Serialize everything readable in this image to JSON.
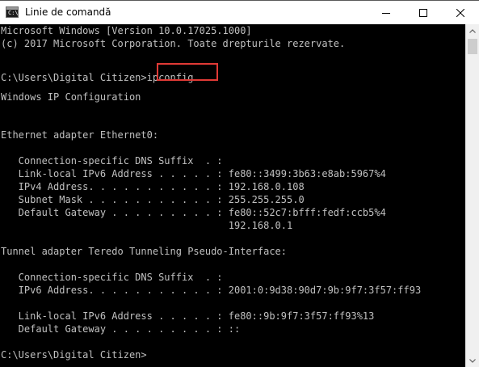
{
  "window": {
    "title": "Linie de comandă",
    "icon_glyph": "C:\\"
  },
  "console": {
    "lines": [
      "Microsoft Windows [Version 10.0.17025.1000]",
      "(c) 2017 Microsoft Corporation. Toate drepturile rezervate.",
      "",
      "C:\\Users\\Digital Citizen>ipconfig",
      "",
      "Windows IP Configuration",
      "",
      "",
      "Ethernet adapter Ethernet0:",
      "",
      "   Connection-specific DNS Suffix  . :",
      "   Link-local IPv6 Address . . . . . : fe80::3499:3b63:e8ab:5967%4",
      "   IPv4 Address. . . . . . . . . . . : 192.168.0.108",
      "   Subnet Mask . . . . . . . . . . . : 255.255.255.0",
      "   Default Gateway . . . . . . . . . : fe80::52c7:bfff:fedf:ccb5%4",
      "                                       192.168.0.1",
      "",
      "Tunnel adapter Teredo Tunneling Pseudo-Interface:",
      "",
      "   Connection-specific DNS Suffix  . :",
      "   IPv6 Address. . . . . . . . . . . : 2001:0:9d38:90d7:9b:9f7:3f57:ff93",
      "",
      "   Link-local IPv6 Address . . . . . : fe80::9b:9f7:3f57:ff93%13",
      "   Default Gateway . . . . . . . . . : ::",
      "",
      "C:\\Users\\Digital Citizen>"
    ]
  },
  "colors": {
    "console_bg": "#000000",
    "console_text": "#c0c0c0",
    "highlight": "#e03a36",
    "titlebar_bg": "#ffffff"
  },
  "icons": {
    "minimize": "minimize-icon",
    "maximize": "maximize-icon",
    "close": "close-icon",
    "scroll_up": "chevron-up-icon",
    "scroll_down": "chevron-down-icon"
  }
}
